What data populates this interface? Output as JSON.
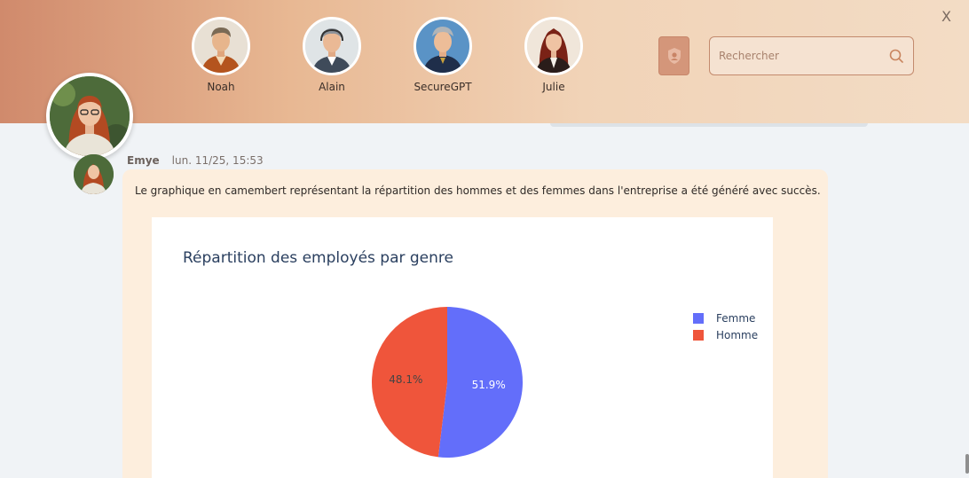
{
  "header": {
    "close_label": "X",
    "agents": [
      {
        "name": "Noah",
        "icon": "noah-avatar"
      },
      {
        "name": "Alain",
        "icon": "alain-avatar"
      },
      {
        "name": "SecureGPT",
        "icon": "securegpt-avatar"
      },
      {
        "name": "Julie",
        "icon": "julie-avatar"
      }
    ],
    "search": {
      "placeholder": "Rechercher",
      "value": ""
    },
    "colors": {
      "gradient_start": "#d08a6c",
      "gradient_end": "#f3dcc5",
      "search_border": "#c38a6d"
    }
  },
  "message": {
    "sender": "Emye",
    "timestamp": "lun. 11/25, 15:53",
    "text": "Le graphique en camembert représentant la répartition des hommes et des femmes dans l'entreprise a été généré avec succès.",
    "bubble_color": "#fdeedd"
  },
  "chart_data": {
    "type": "pie",
    "title": "Répartition des employés par genre",
    "categories": [
      "Femme",
      "Homme"
    ],
    "values": [
      51.9,
      48.1
    ],
    "labels": [
      "51.9%",
      "48.1%"
    ],
    "colors": [
      "#636efa",
      "#ef553b"
    ],
    "legend_position": "top-right"
  }
}
